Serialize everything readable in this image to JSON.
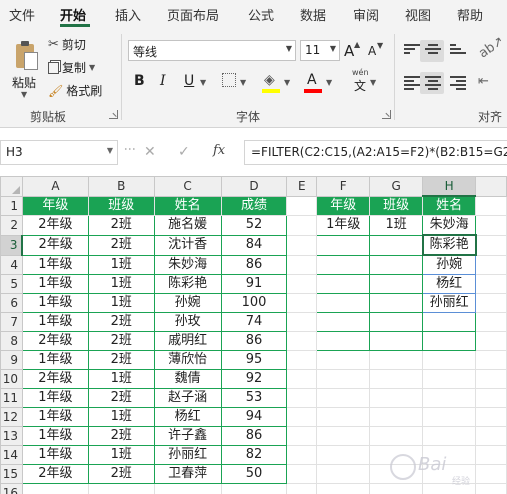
{
  "ribbon": {
    "tabs": [
      "文件",
      "开始",
      "插入",
      "页面布局",
      "公式",
      "数据",
      "审阅",
      "视图",
      "帮助"
    ],
    "active_tab": "开始",
    "clipboard": {
      "paste": "粘贴",
      "cut": "剪切",
      "copy": "复制",
      "format_painter": "格式刷",
      "group_label": "剪贴板"
    },
    "font": {
      "name": "等线",
      "size": "11",
      "bold": "B",
      "italic": "I",
      "underline": "U",
      "grow": "A",
      "shrink": "A",
      "phonetic": "wén",
      "phonetic_char": "文",
      "group_label": "字体",
      "fill_color": "#ffff00",
      "font_color": "#ff0000"
    },
    "alignment": {
      "group_label": "对齐"
    }
  },
  "formula_bar": {
    "name_box": "H3",
    "cancel": "✕",
    "enter": "✓",
    "fx": "fx",
    "formula": "=FILTER(C2:C15,(A2:A15=F2)*(B2:B15=G2))"
  },
  "sheet": {
    "columns": [
      "A",
      "B",
      "C",
      "D",
      "E",
      "F",
      "G",
      "H"
    ],
    "rows": [
      "1",
      "2",
      "3",
      "4",
      "5",
      "6",
      "7",
      "8",
      "9",
      "10",
      "11",
      "12",
      "13",
      "14",
      "15",
      "16"
    ],
    "active_cell": "H3",
    "header_color": "#1aa354",
    "main_table": {
      "headers": [
        "年级",
        "班级",
        "姓名",
        "成绩"
      ],
      "records": [
        [
          "2年级",
          "2班",
          "施名媛",
          "52"
        ],
        [
          "2年级",
          "2班",
          "沈计香",
          "84"
        ],
        [
          "1年级",
          "1班",
          "朱妙海",
          "86"
        ],
        [
          "1年级",
          "1班",
          "陈彩艳",
          "91"
        ],
        [
          "1年级",
          "1班",
          "孙婉",
          "100"
        ],
        [
          "1年级",
          "2班",
          "孙玫",
          "74"
        ],
        [
          "2年级",
          "2班",
          "戚明红",
          "86"
        ],
        [
          "1年级",
          "2班",
          "薄欣怡",
          "95"
        ],
        [
          "2年级",
          "1班",
          "魏倩",
          "92"
        ],
        [
          "1年级",
          "2班",
          "赵子涵",
          "53"
        ],
        [
          "1年级",
          "1班",
          "杨红",
          "94"
        ],
        [
          "1年级",
          "2班",
          "许子鑫",
          "86"
        ],
        [
          "1年级",
          "1班",
          "孙丽红",
          "82"
        ],
        [
          "2年级",
          "2班",
          "卫春萍",
          "50"
        ]
      ]
    },
    "filter_table": {
      "headers": [
        "年级",
        "班级",
        "姓名"
      ],
      "criteria": [
        "1年级",
        "1班"
      ],
      "results": [
        "朱妙海",
        "陈彩艳",
        "孙婉",
        "杨红",
        "孙丽红"
      ]
    }
  },
  "watermark": {
    "text": "Bai",
    "sub": "经验"
  }
}
